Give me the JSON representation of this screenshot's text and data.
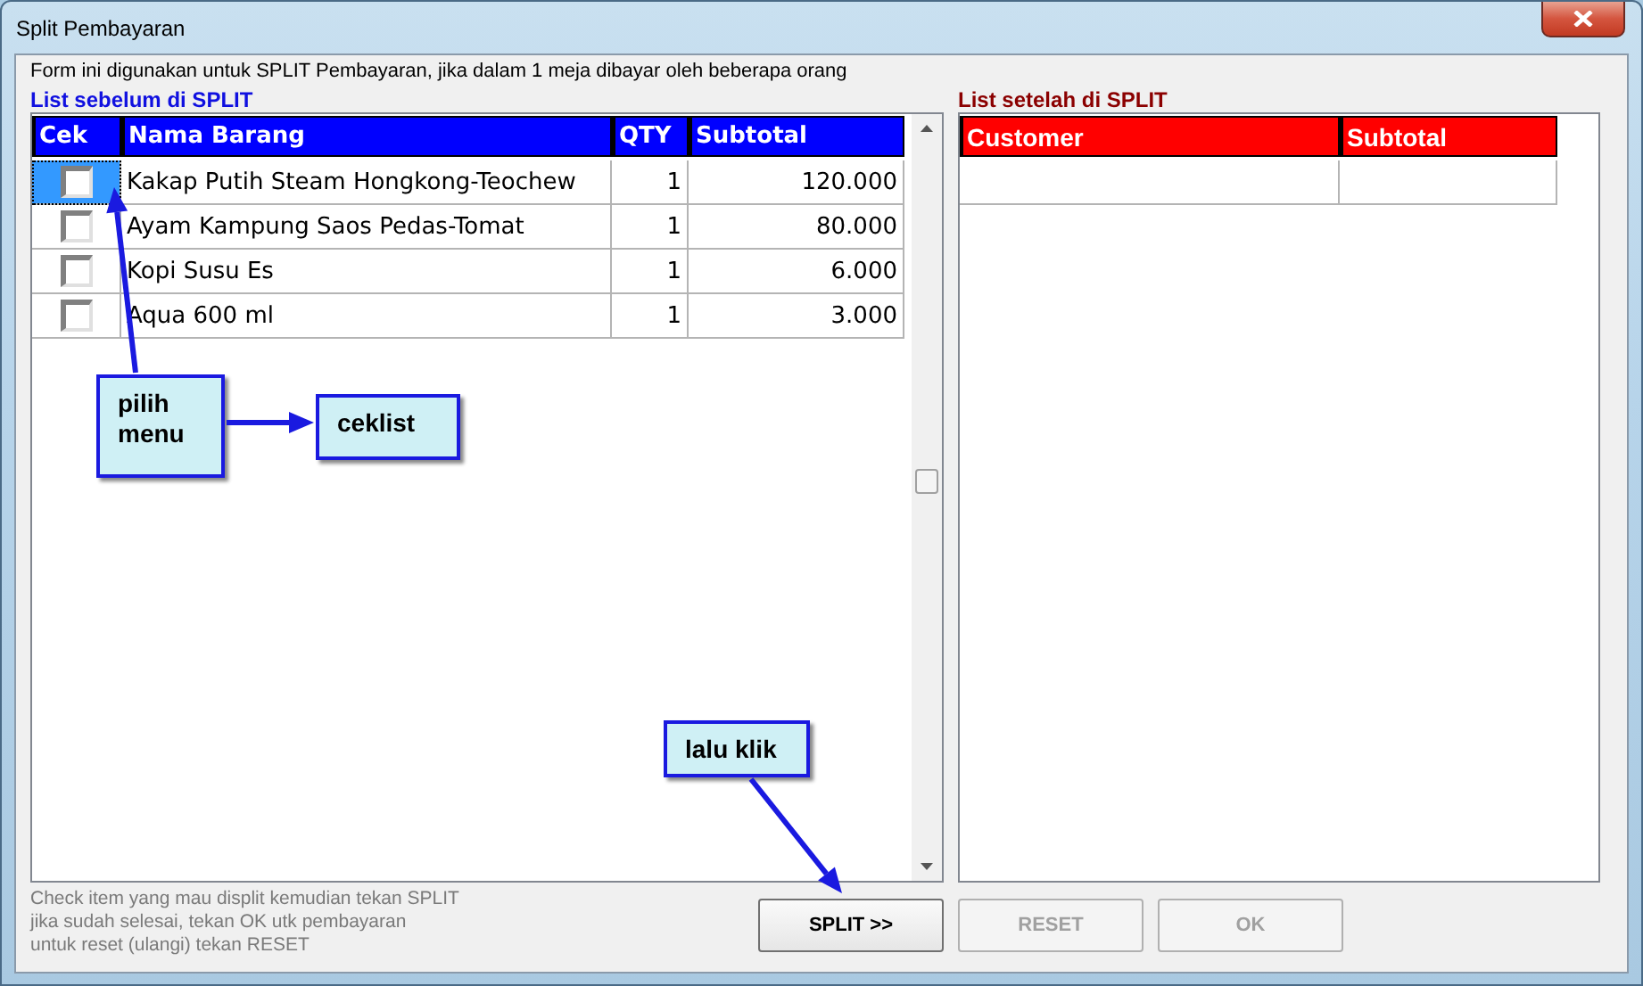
{
  "window": {
    "title": "Split Pembayaran"
  },
  "description": "Form ini digunakan untuk SPLIT Pembayaran, jika dalam 1 meja dibayar oleh beberapa orang",
  "before_list": {
    "title": "List sebelum di SPLIT",
    "columns": [
      "Cek",
      "Nama Barang",
      "QTY",
      "Subtotal"
    ],
    "rows": [
      {
        "checked": false,
        "selected": true,
        "name": "Kakap Putih Steam Hongkong-Teochew",
        "qty": "1",
        "subtotal": "120.000"
      },
      {
        "checked": false,
        "selected": false,
        "name": "Ayam Kampung Saos Pedas-Tomat",
        "qty": "1",
        "subtotal": "80.000"
      },
      {
        "checked": false,
        "selected": false,
        "name": "Kopi Susu Es",
        "qty": "1",
        "subtotal": "6.000"
      },
      {
        "checked": false,
        "selected": false,
        "name": "Aqua 600 ml",
        "qty": "1",
        "subtotal": "3.000"
      }
    ]
  },
  "after_list": {
    "title": "List setelah di SPLIT",
    "columns": [
      "Customer",
      "Subtotal"
    ]
  },
  "help_lines": [
    "Check item yang mau displit kemudian tekan SPLIT",
    "jika sudah selesai, tekan OK utk pembayaran",
    "untuk reset (ulangi) tekan RESET"
  ],
  "buttons": [
    {
      "label": "SPLIT >>",
      "disabled": false
    },
    {
      "label": "RESET",
      "disabled": true
    },
    {
      "label": "OK",
      "disabled": true
    }
  ],
  "annotations": [
    {
      "text": "pilih menu"
    },
    {
      "text": "ceklist"
    },
    {
      "text": "lalu klik"
    }
  ]
}
